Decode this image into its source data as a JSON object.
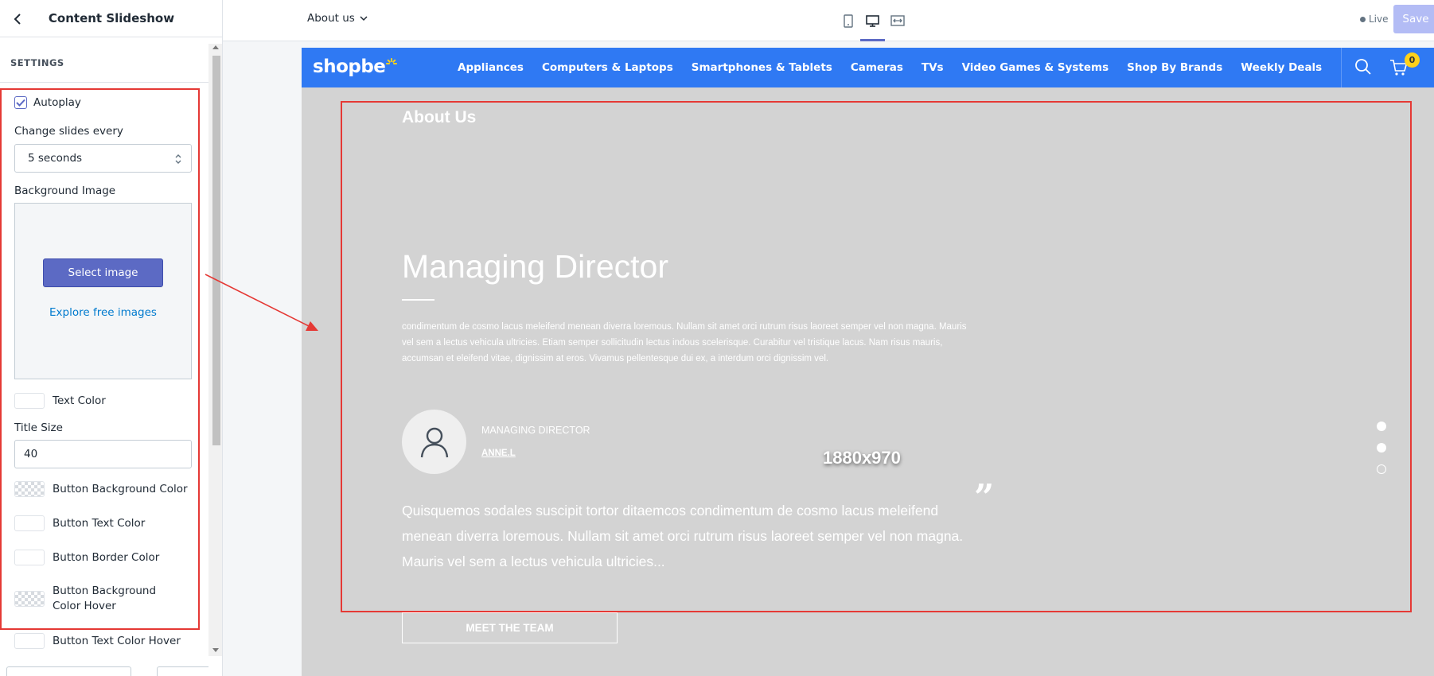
{
  "panel": {
    "title": "Content Slideshow",
    "section": "SETTINGS",
    "autoplay_label": "Autoplay",
    "change_slides_label": "Change slides every",
    "change_slides_value": "5 seconds",
    "background_image_label": "Background Image",
    "select_image_button": "Select image",
    "explore_link": "Explore free images",
    "text_color_label": "Text Color",
    "title_size_label": "Title Size",
    "title_size_value": "40",
    "button_bg_color_label": "Button Background Color",
    "button_text_color_label": "Button Text Color",
    "button_border_color_label": "Button Border Color",
    "button_bg_hover_label": "Button Background Color Hover",
    "button_text_hover_label": "Button Text Color Hover"
  },
  "topbar": {
    "page_picker": "About us",
    "live_label": "Live",
    "save_label": "Save"
  },
  "site": {
    "logo_text": "shopbe",
    "nav": [
      "Appliances",
      "Computers & Laptops",
      "Smartphones & Tablets",
      "Cameras",
      "TVs",
      "Video Games & Systems",
      "Shop By Brands",
      "Weekly Deals"
    ],
    "cart_count": "0",
    "section_title": "About Us",
    "slide_heading": "Managing Director",
    "slide_body": "condimentum de cosmo lacus meleifend menean diverra loremous. Nullam sit amet orci rutrum risus laoreet semper vel non magna. Mauris vel sem a lectus vehicula ultricies. Etiam semper sollicitudin lectus indous scelerisque. Curabitur vel tristique lacus. Nam risus mauris, accumsan et eleifend vitae, dignissim at eros. Vivamus pellentesque dui ex, a interdum orci dignissim vel.",
    "person_role": "MANAGING DIRECTOR",
    "person_name": "ANNE.L",
    "image_size_watermark": "1880x970",
    "quote_text": "Quisquemos sodales suscipit tortor ditaemcos condimentum de cosmo lacus meleifend menean diverra loremous. Nullam sit amet orci rutrum risus laoreet semper vel non magna. Mauris vel sem a lectus vehicula ultricies...",
    "meet_button": "MEET THE TEAM"
  },
  "colors": {
    "accent": "#5c6ac4",
    "nav_blue": "#2f79f3",
    "annotation_red": "#e53935",
    "slide_bg": "#d3d3d3",
    "cart_badge": "#ffd11a"
  }
}
